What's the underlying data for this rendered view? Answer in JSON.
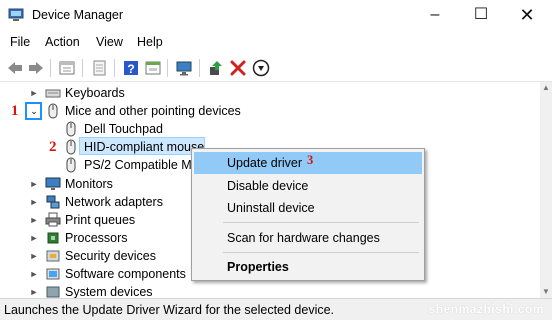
{
  "window": {
    "title": "Device Manager"
  },
  "menubar": {
    "items": [
      "File",
      "Action",
      "View",
      "Help"
    ]
  },
  "toolbar": {
    "icons": [
      "back-arrow-icon",
      "forward-arrow-icon",
      "properties-sheet-icon",
      "document-icon",
      "help-icon",
      "panel-icon",
      "monitor-icon",
      "update-driver-icon",
      "uninstall-x-icon",
      "download-icon"
    ]
  },
  "tree": {
    "rows": [
      {
        "label": "Keyboards",
        "icon": "keyboard-icon",
        "expander": "collapsed"
      },
      {
        "label": "Mice and other pointing devices",
        "icon": "mouse-icon",
        "expander": "expanded"
      },
      {
        "label": "Dell Touchpad",
        "icon": "mouse-icon"
      },
      {
        "label": "HID-compliant mouse",
        "icon": "mouse-icon",
        "selected": true
      },
      {
        "label": "PS/2 Compatible Mo",
        "icon": "mouse-icon"
      },
      {
        "label": "Monitors",
        "icon": "monitor-icon",
        "expander": "collapsed"
      },
      {
        "label": "Network adapters",
        "icon": "network-icon",
        "expander": "collapsed"
      },
      {
        "label": "Print queues",
        "icon": "printer-icon",
        "expander": "collapsed"
      },
      {
        "label": "Processors",
        "icon": "chip-icon",
        "expander": "collapsed"
      },
      {
        "label": "Security devices",
        "icon": "security-icon",
        "expander": "collapsed"
      },
      {
        "label": "Software components",
        "icon": "component-icon",
        "expander": "collapsed"
      },
      {
        "label": "System devices",
        "icon": "system-icon",
        "expander": "collapsed"
      }
    ]
  },
  "steps": {
    "one": "1",
    "two": "2",
    "three": "3"
  },
  "context_menu": {
    "items": [
      "Update driver",
      "Disable device",
      "Uninstall device",
      "Scan for hardware changes",
      "Properties"
    ],
    "active": "Update driver",
    "bold": "Properties"
  },
  "status": {
    "text": "Launches the Update Driver Wizard for the selected device.",
    "watermark": "shenmazhishi.com"
  },
  "colors": {
    "selection": "#cce8ff",
    "menu_highlight": "#91c9f7",
    "step_red": "#dd1111",
    "focus_box": "#1e90ff"
  }
}
